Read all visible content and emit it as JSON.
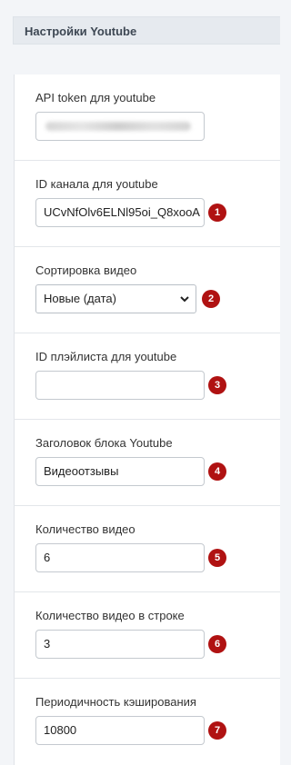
{
  "section": {
    "title": "Настройки Youtube"
  },
  "fields": {
    "api_token": {
      "label": "API token для youtube",
      "value": ""
    },
    "channel_id": {
      "label": "ID канала для youtube",
      "value": "UCvNfOlv6ELNl95oi_Q8xooA",
      "badge": "1"
    },
    "sort": {
      "label": "Сортировка видео",
      "value": "Новые (дата)",
      "badge": "2"
    },
    "playlist_id": {
      "label": "ID плэйлиста для youtube",
      "value": "",
      "badge": "3"
    },
    "block_title": {
      "label": "Заголовок блока Youtube",
      "value": "Видеоотзывы",
      "badge": "4"
    },
    "video_count": {
      "label": "Количество видео",
      "value": "6",
      "badge": "5"
    },
    "videos_per_row": {
      "label": "Количество видео в строке",
      "value": "3",
      "badge": "6"
    },
    "cache_period": {
      "label": "Периодичность кэширования",
      "value": "10800",
      "badge": "7"
    }
  },
  "colors": {
    "badge": "#b01212",
    "header_bg": "#e6eaef",
    "page_bg": "#f3f5f8"
  },
  "icons": {
    "select_arrow": "chevron-down-icon"
  }
}
